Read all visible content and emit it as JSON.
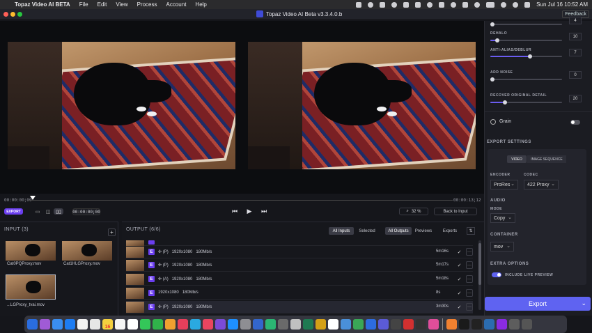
{
  "menubar": {
    "app_name": "Topaz Video AI BETA",
    "items": [
      "File",
      "Edit",
      "View",
      "Process",
      "Account",
      "Help"
    ],
    "datetime": "Sun Jul 16  10:52 AM"
  },
  "window": {
    "title": "Topaz Video AI Beta  v3.3.4.0.b",
    "feedback_label": "Feedback"
  },
  "timeline": {
    "start_time": "00:00:00;00",
    "end_time": "00:00:13;12",
    "current_time": "00:00:00;00",
    "export_label": "EXPORT",
    "zoom": "32 %",
    "back_to_input": "Back to Input"
  },
  "input_panel": {
    "title": "INPUT (3)",
    "add_label": "+",
    "files": [
      {
        "name": "Cat0PQProxy.mov"
      },
      {
        "name": "Cat1HLGProxy.mov"
      },
      {
        "name": "...LGProxy_tvai.mov"
      }
    ]
  },
  "output_panel": {
    "title": "OUTPUT (6/6)",
    "filter_tabs": [
      "All Inputs",
      "Selected"
    ],
    "view_tabs": [
      "All Outputs",
      "Previews",
      "Exports"
    ],
    "rows": [
      {
        "badge": "E",
        "text": "✣ (P)   1920x1080   180Mb/s",
        "time": "5m16s"
      },
      {
        "badge": "E",
        "text": "✣ (P)   1920x1080   180Mb/s",
        "time": "5m17s"
      },
      {
        "badge": "E",
        "text": "✣ (A)   1920x1080   180Mb/s",
        "time": "5m18s"
      },
      {
        "badge": "E",
        "text": "1920x1080   180Mb/s",
        "time": "8s"
      },
      {
        "badge": "E",
        "text": "✣ (P)   1920x1080   180Mb/s",
        "time": "3m30s"
      }
    ],
    "check": "✓",
    "more": "···"
  },
  "enhance": {
    "sliders": [
      {
        "label": "DEHALO",
        "value": "10",
        "fraction": 0.1
      },
      {
        "label": "ANTI-ALIAS/DEBLUR",
        "value": "7",
        "fraction": 0.55
      },
      {
        "label": "ADD NOISE",
        "value": "0",
        "fraction": 0.0
      },
      {
        "label": "RECOVER ORIGINAL DETAIL",
        "value": "20",
        "fraction": 0.2
      }
    ],
    "top_value": "4",
    "grain_label": "Grain"
  },
  "export_settings": {
    "title": "EXPORT SETTINGS",
    "tabs": [
      "VIDEO",
      "IMAGE SEQUENCE"
    ],
    "encoder_label": "ENCODER",
    "encoder_value": "ProRes",
    "codec_label": "CODEC",
    "codec_value": "422 Proxy",
    "audio_label": "AUDIO",
    "mode_label": "MODE",
    "mode_value": "Copy",
    "container_label": "CONTAINER",
    "container_value": "mov",
    "extra_label": "EXTRA OPTIONS",
    "live_preview_label": "INCLUDE LIVE PREVIEW",
    "export_button": "Export"
  },
  "dock": {
    "calendar_day": "16",
    "icons": [
      "#2a6de0",
      "#a05bd6",
      "#3a8ef0",
      "#1d7cf2",
      "#f2f2f2",
      "#e6e6e6",
      "#f4d03f",
      "#f5f5f5",
      "#ffffff",
      "#34c759",
      "#30b24a",
      "#f0a030",
      "#e83f5b",
      "#2aa9e0",
      "#e94560",
      "#7b4bd8",
      "#1e90ff",
      "#8e8e93",
      "#3366cc",
      "#2bb673",
      "#6a6a6a",
      "#c0c0c0",
      "#1f7a52",
      "#d4a017",
      "#ffffff",
      "#4a90d9",
      "#3aa757",
      "#2d6cdf",
      "#5b5bd6",
      "#444444",
      "#d23030",
      "#333333",
      "#e04e9a",
      "#f08030",
      "#1a1a1a",
      "#222222",
      "#2b6cb0",
      "#8a2be2",
      "#5d5d5d",
      "#555555"
    ]
  }
}
